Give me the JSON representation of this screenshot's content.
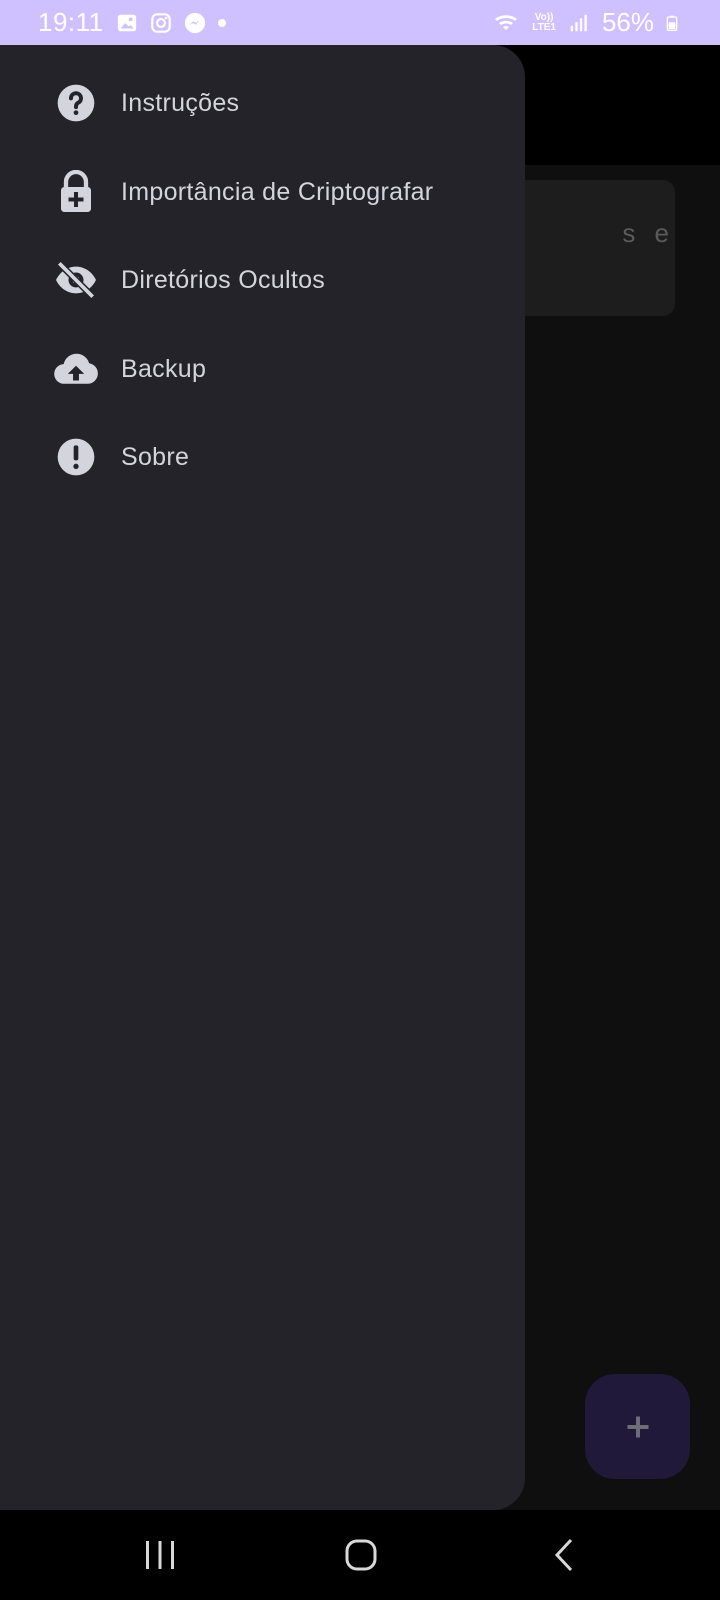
{
  "status_bar": {
    "time": "19:11",
    "battery": "56%",
    "network": "LTE1",
    "volte": "Vo))",
    "left_icons": [
      "gallery-icon",
      "instagram-icon",
      "messenger-icon",
      "notification-dot"
    ],
    "right_icons": [
      "wifi-icon",
      "volte-icon",
      "signal-icon",
      "battery-icon"
    ]
  },
  "background_app": {
    "card_text_fragment": "s e",
    "fab": {
      "icon": "plus-icon"
    }
  },
  "drawer": {
    "items": [
      {
        "label": "Instruções",
        "icon": "help-circle-icon"
      },
      {
        "label": "Importância  de Criptografar",
        "icon": "lock-plus-icon"
      },
      {
        "label": "Diretórios Ocultos",
        "icon": "eye-off-icon"
      },
      {
        "label": "Backup",
        "icon": "cloud-upload-icon"
      },
      {
        "label": "Sobre",
        "icon": "alert-circle-icon"
      }
    ]
  },
  "nav_bar": {
    "buttons": [
      "recent-apps-icon",
      "home-icon",
      "back-icon"
    ]
  },
  "colors": {
    "status_bar": "#cfc0ff",
    "drawer_bg": "#232329",
    "text": "#d4d4dc",
    "fab_bg": "#21193a"
  }
}
